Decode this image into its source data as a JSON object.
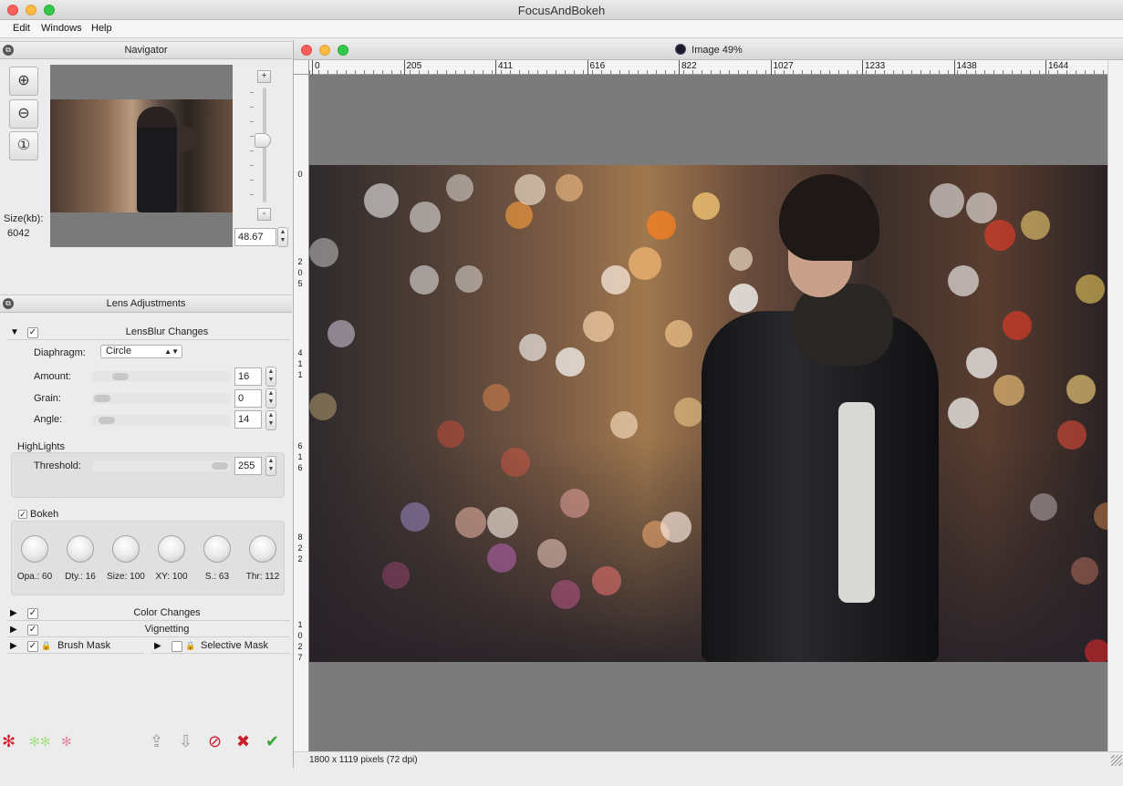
{
  "app": {
    "title": "FocusAndBokeh",
    "menu": [
      "Edit",
      "Windows",
      "Help"
    ]
  },
  "navigator": {
    "title": "Navigator",
    "size_label": "Size(kb):",
    "size_value": "6042",
    "zoom_value": "48.67",
    "zoom_in_icon": "zoom-in-icon",
    "zoom_out_icon": "zoom-out-icon",
    "zoom_actual_icon": "zoom-actual-icon"
  },
  "lens": {
    "title": "Lens Adjustments",
    "lensblur": {
      "label": "LensBlur Changes",
      "checked": true,
      "diaphragm_label": "Diaphragm:",
      "diaphragm_value": "Circle",
      "amount_label": "Amount:",
      "amount_value": "16",
      "grain_label": "Grain:",
      "grain_value": "0",
      "angle_label": "Angle:",
      "angle_value": "14"
    },
    "highlights": {
      "label": "HighLights",
      "threshold_label": "Threshold:",
      "threshold_value": "255"
    },
    "bokeh": {
      "label": "Bokeh",
      "checked": true,
      "knobs": [
        "Opa.: 60",
        "Dty.: 16",
        "Size: 100",
        "XY: 100",
        "S.: 63",
        "Thr: 112"
      ]
    },
    "sections": {
      "color_changes": "Color Changes",
      "vignetting": "Vignetting",
      "brush_mask": "Brush Mask",
      "selective_mask": "Selective Mask"
    }
  },
  "image_window": {
    "title": "Image 49%",
    "ruler_h": [
      "0",
      "205",
      "411",
      "616",
      "822",
      "1027",
      "1233",
      "1438",
      "1644"
    ],
    "ruler_v": [
      {
        "chars": [
          "0"
        ]
      },
      {
        "chars": [
          "2",
          "0",
          "5"
        ]
      },
      {
        "chars": [
          "4",
          "1",
          "1"
        ]
      },
      {
        "chars": [
          "6",
          "1",
          "6"
        ]
      },
      {
        "chars": [
          "8",
          "2",
          "2"
        ]
      },
      {
        "chars": [
          "1",
          "0",
          "2",
          "7"
        ]
      }
    ],
    "status": "1800 x 1119 pixels (72 dpi)"
  },
  "colors": {
    "accent_red": "#d8202a",
    "accent_green": "#3aa83a"
  }
}
